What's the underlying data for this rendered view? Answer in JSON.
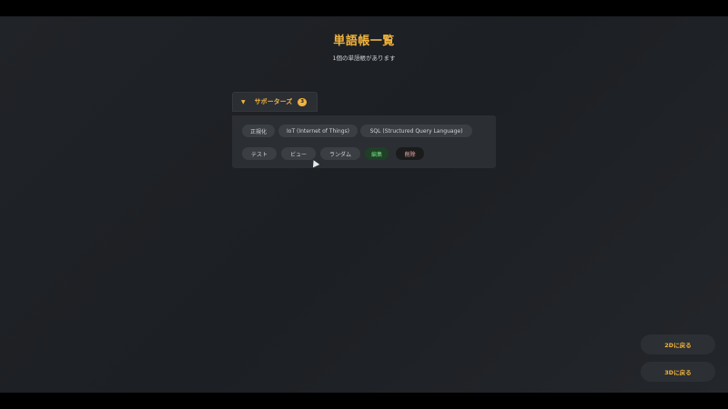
{
  "header": {
    "title": "単語帳一覧",
    "subtitle": "1個の単語帳があります"
  },
  "group": {
    "name": "サポーターズ",
    "count": "3",
    "toggle_icon": "▼",
    "words": [
      "正規化",
      "IoT (Internet of Things)",
      "SQL (Structured Query Language)"
    ],
    "actions": {
      "test": "テスト",
      "view": "ビュー",
      "random": "ランダム",
      "edit": "編集",
      "delete": "削除"
    }
  },
  "nav": {
    "back_2d": "2Dに戻る",
    "back_3d": "3Dに戻る"
  },
  "colors": {
    "accent": "#f2b33d",
    "edit_text": "#6fdc7f",
    "delete_text": "#f2b0b0"
  }
}
